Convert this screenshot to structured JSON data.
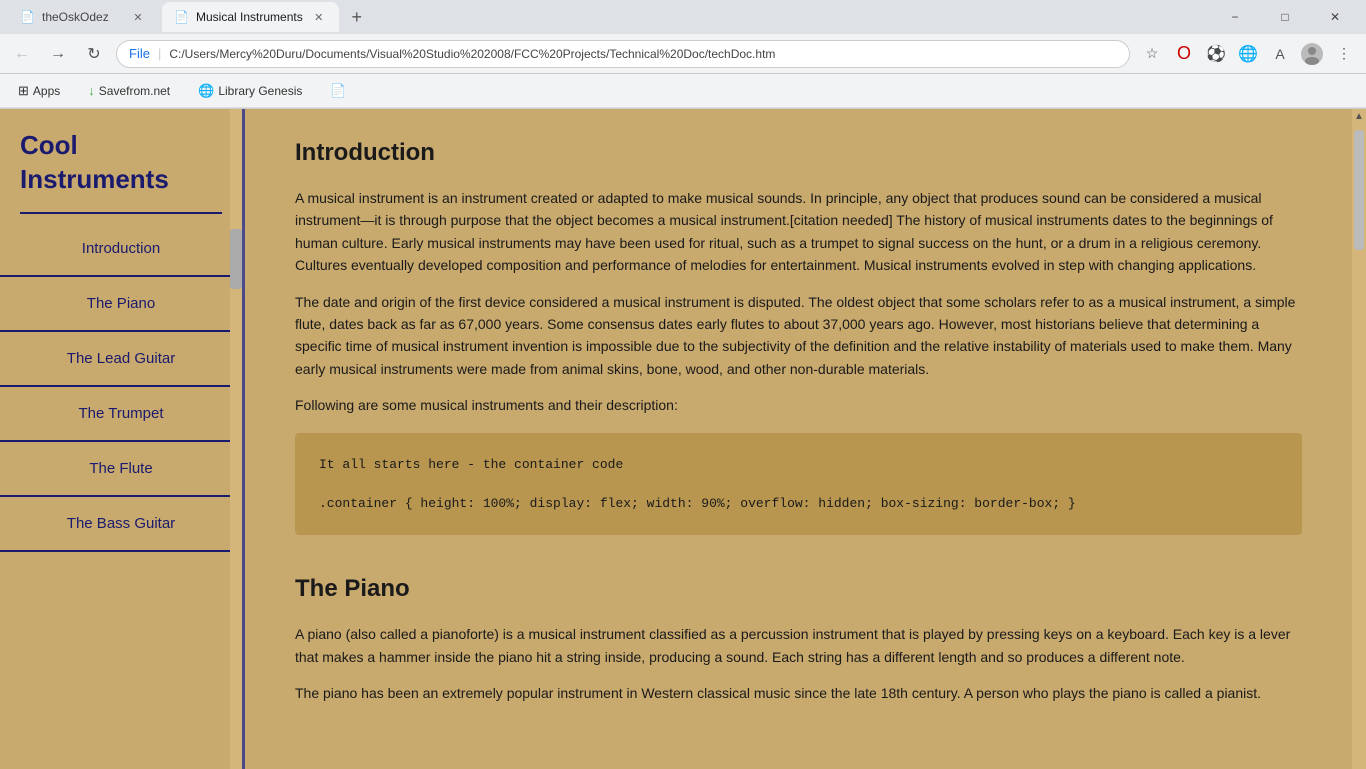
{
  "browser": {
    "tabs": [
      {
        "label": "theOskOdez",
        "active": false,
        "icon": "📄"
      },
      {
        "label": "Musical Instruments",
        "active": true,
        "icon": "📄"
      }
    ],
    "new_tab_label": "+",
    "window_controls": [
      "−",
      "□",
      "✕"
    ],
    "address": {
      "protocol": "File",
      "url": "C:/Users/Mercy%20Duru/Documents/Visual%20Studio%202008/FCC%20Projects/Technical%20Doc/techDoc.htm"
    },
    "bookmarks": [
      {
        "icon": "⊞",
        "label": "Apps"
      },
      {
        "icon": "↓",
        "label": "Savefrom.net"
      },
      {
        "icon": "🌐",
        "label": "Library Genesis"
      },
      {
        "icon": "📄",
        "label": ""
      }
    ]
  },
  "sidebar": {
    "title": "Cool Instruments",
    "nav_items": [
      {
        "label": "Introduction",
        "href": "#introduction"
      },
      {
        "label": "The Piano",
        "href": "#piano"
      },
      {
        "label": "The Lead Guitar",
        "href": "#lead-guitar"
      },
      {
        "label": "The Trumpet",
        "href": "#trumpet"
      },
      {
        "label": "The Flute",
        "href": "#flute"
      },
      {
        "label": "The Bass Guitar",
        "href": "#bass-guitar"
      }
    ]
  },
  "content": {
    "sections": [
      {
        "id": "introduction",
        "title": "Introduction",
        "paragraphs": [
          "A musical instrument is an instrument created or adapted to make musical sounds. In principle, any object that produces sound can be considered a musical instrument—it is through purpose that the object becomes a musical instrument.[citation needed] The history of musical instruments dates to the beginnings of human culture. Early musical instruments may have been used for ritual, such as a trumpet to signal success on the hunt, or a drum in a religious ceremony. Cultures eventually developed composition and performance of melodies for entertainment. Musical instruments evolved in step with changing applications.",
          "The date and origin of the first device considered a musical instrument is disputed. The oldest object that some scholars refer to as a musical instrument, a simple flute, dates back as far as 67,000 years. Some consensus dates early flutes to about 37,000 years ago. However, most historians believe that determining a specific time of musical instrument invention is impossible due to the subjectivity of the definition and the relative instability of materials used to make them. Many early musical instruments were made from animal skins, bone, wood, and other non-durable materials.",
          "Following are some musical instruments and their description:"
        ],
        "code": "It all starts here - the container code\n\n.container { height: 100%; display: flex; width: 90%; overflow: hidden; box-sizing: border-box; }"
      },
      {
        "id": "piano",
        "title": "The Piano",
        "paragraphs": [
          "A piano (also called a pianoforte) is a musical instrument classified as a percussion instrument that is played by pressing keys on a keyboard. Each key is a lever that makes a hammer inside the piano hit a string inside, producing a sound. Each string has a different length and so produces a different note.",
          "The piano has been an extremely popular instrument in Western classical music since the late 18th century. A person who plays the piano is called a pianist."
        ]
      }
    ]
  }
}
